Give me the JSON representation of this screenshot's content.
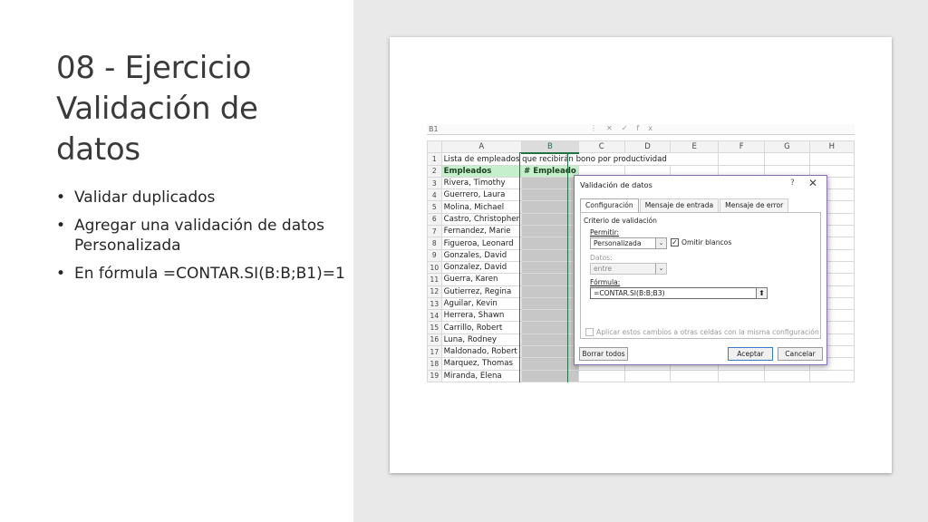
{
  "slide": {
    "title": "08 - Ejercicio Validación de datos",
    "bullets": [
      "Validar duplicados",
      "Agregar una validación de datos Personalizada",
      "En fórmula =CONTAR.SI(B:B;B1)=1"
    ],
    "bullet_glyph": "•"
  },
  "excel": {
    "namebox": "B1",
    "toolbar_glyphs": [
      "⋮",
      "✕",
      "✓",
      "fx"
    ],
    "columns": [
      "A",
      "B",
      "C",
      "D",
      "E",
      "F",
      "G",
      "H"
    ],
    "title_text": "Lista de empleados que recibirán bono por productividad",
    "header_a": "Empleados",
    "header_b": "# Empleado",
    "rows": [
      {
        "num": "1",
        "name": ""
      },
      {
        "num": "2",
        "name": ""
      },
      {
        "num": "3",
        "name": "Rivera, Timothy"
      },
      {
        "num": "4",
        "name": "Guerrero, Laura"
      },
      {
        "num": "5",
        "name": "Molina, Michael"
      },
      {
        "num": "6",
        "name": "Castro, Christopher"
      },
      {
        "num": "7",
        "name": "Fernandez, Marie"
      },
      {
        "num": "8",
        "name": "Figueroa, Leonard"
      },
      {
        "num": "9",
        "name": "Gonzales, David"
      },
      {
        "num": "10",
        "name": "Gonzalez, David"
      },
      {
        "num": "11",
        "name": "Guerra, Karen"
      },
      {
        "num": "12",
        "name": "Gutierrez, Regina"
      },
      {
        "num": "13",
        "name": "Aguilar, Kevin"
      },
      {
        "num": "14",
        "name": "Herrera, Shawn"
      },
      {
        "num": "15",
        "name": "Carrillo, Robert"
      },
      {
        "num": "16",
        "name": "Luna, Rodney"
      },
      {
        "num": "17",
        "name": "Maldonado, Robert"
      },
      {
        "num": "18",
        "name": "Marquez, Thomas"
      },
      {
        "num": "19",
        "name": "Miranda, Elena"
      }
    ]
  },
  "dialog": {
    "title": "Validación de datos",
    "help": "?",
    "close": "✕",
    "tabs": [
      "Configuración",
      "Mensaje de entrada",
      "Mensaje de error"
    ],
    "criteria_label": "Criterio de validación",
    "permitir_label": "Permitir:",
    "permitir_value": "Personalizada",
    "omitir_label": "Omitir blancos",
    "omitir_check": "✓",
    "datos_label": "Datos:",
    "datos_value": "entre",
    "formula_label": "Fórmula:",
    "formula_value": "=CONTAR.SI(B:B;B3)",
    "formula_btn": "⬆",
    "dropdown_glyph": "⌄",
    "apply_label": "Aplicar estos cambios a otras celdas con la misma configuración",
    "btn_borrar": "Borrar todos",
    "btn_aceptar": "Aceptar",
    "btn_cancelar": "Cancelar"
  },
  "colors": {
    "panel_bg": "#e9e9e9",
    "header_green": "#c6efce",
    "selection_green": "#217346",
    "dialog_border": "#8b6fb3"
  }
}
